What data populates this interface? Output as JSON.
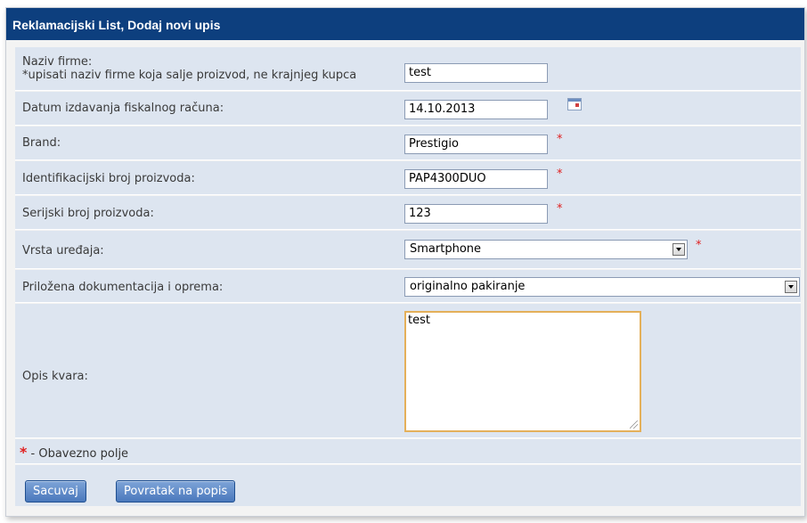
{
  "title": "Reklamacijski List, Dodaj novi upis",
  "fields": {
    "naziv_firme": {
      "label": "Naziv firme:",
      "hint": "*upisati naziv firme koja salje proizvod, ne krajnjeg kupca",
      "value": "test"
    },
    "datum": {
      "label": "Datum izdavanja fiskalnog računa:",
      "value": "14.10.2013"
    },
    "brand": {
      "label": "Brand:",
      "value": "Prestigio",
      "required": "*"
    },
    "id_broj": {
      "label": "Identifikacijski broj proizvoda:",
      "value": "PAP4300DUO",
      "required": "*"
    },
    "serijski": {
      "label": "Serijski broj proizvoda:",
      "value": "123",
      "required": "*"
    },
    "vrsta": {
      "label": "Vrsta uređaja:",
      "value": "Smartphone",
      "required": "*"
    },
    "dokumentacija": {
      "label": "Priložena dokumentacija i oprema:",
      "value": "originalno pakiranje"
    },
    "opis": {
      "label": "Opis kvara:",
      "value": "test"
    }
  },
  "legend": {
    "marker": "*",
    "text": " - Obavezno polje"
  },
  "buttons": {
    "save": "Sacuvaj",
    "back": "Povratak na popis"
  },
  "colors": {
    "titlebar": "#0d3f7e",
    "row_bg": "#dde5f0",
    "required": "#e02020",
    "button": "#4a78bc"
  }
}
